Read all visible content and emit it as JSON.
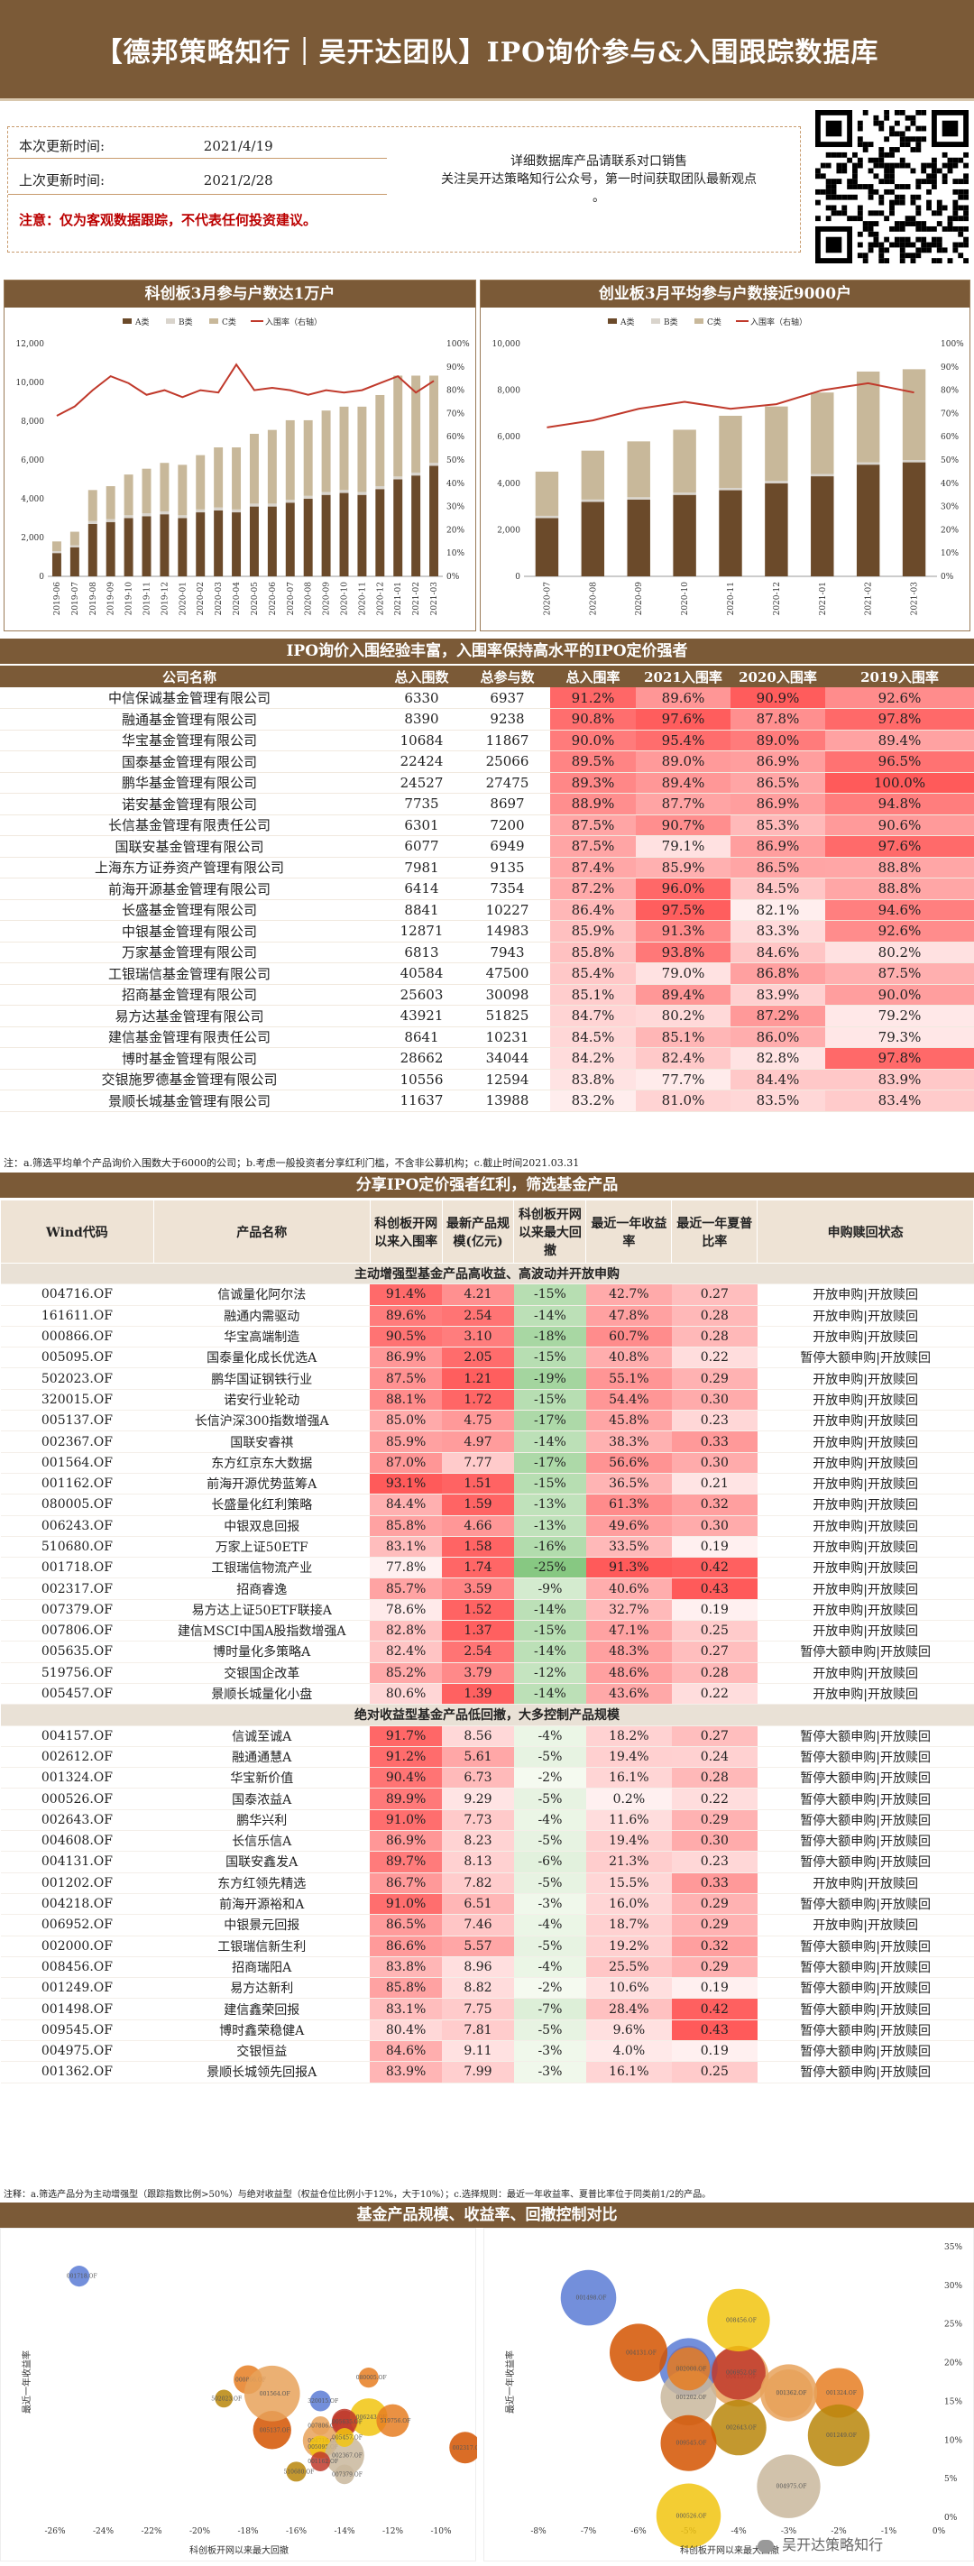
{
  "header": {
    "title": "【德邦策略知行｜吴开达团队】IPO询价参与&入围跟踪数据库"
  },
  "info": {
    "this_update_label": "本次更新时间:",
    "this_update": "2021/4/19",
    "last_update_label": "上次更新时间:",
    "last_update": "2021/2/28",
    "note": "注意：仅为客观数据跟踪，不代表任何投资建议。",
    "contact": "详细数据库产品请联系对口销售",
    "follow": "关注吴开达策略知行公众号，第一时间获取团队最新观点",
    "follow_tail": "。"
  },
  "chart1": {
    "title": "科创板3月参与户数达1万户",
    "legend": [
      "A类",
      "B类",
      "C类",
      "入围率（右轴）"
    ]
  },
  "chart2": {
    "title": "创业板3月平均参与户数接近9000户",
    "legend": [
      "A类",
      "B类",
      "C类",
      "入围率（右轴）"
    ]
  },
  "chart_data": [
    {
      "type": "bar",
      "stacked": true,
      "categories": [
        "2019-06",
        "2019-07",
        "2019-08",
        "2019-09",
        "2019-10",
        "2019-11",
        "2019-12",
        "2020-01",
        "2020-02",
        "2020-03",
        "2020-04",
        "2020-05",
        "2020-06",
        "2020-07",
        "2020-08",
        "2020-09",
        "2020-10",
        "2020-11",
        "2020-12",
        "2021-01",
        "2021-02",
        "2021-03"
      ],
      "series": [
        {
          "name": "A类",
          "values": [
            1200,
            1500,
            2700,
            2800,
            3000,
            3100,
            3200,
            3000,
            3300,
            3400,
            3300,
            3600,
            3600,
            3800,
            4000,
            4200,
            4300,
            4200,
            4500,
            5000,
            5200,
            5700
          ]
        },
        {
          "name": "B类",
          "values": [
            100,
            100,
            150,
            150,
            150,
            150,
            150,
            150,
            150,
            150,
            150,
            150,
            150,
            150,
            150,
            150,
            150,
            150,
            150,
            150,
            150,
            150
          ]
        },
        {
          "name": "C类",
          "values": [
            500,
            700,
            1600,
            1700,
            2100,
            2300,
            2500,
            2600,
            2800,
            3100,
            3200,
            3600,
            3800,
            4100,
            3900,
            4200,
            4300,
            4400,
            4700,
            5200,
            5000,
            4500
          ]
        }
      ],
      "line": {
        "name": "入围率（右轴）",
        "values": [
          69,
          73,
          80,
          86,
          83,
          78,
          80,
          77,
          80,
          79,
          91,
          80,
          81,
          80,
          78,
          80,
          79,
          80,
          83,
          86,
          79,
          84
        ]
      },
      "ylim": [
        0,
        12000
      ],
      "y2lim": [
        0,
        100
      ]
    },
    {
      "type": "bar",
      "stacked": true,
      "categories": [
        "2020-07",
        "2020-08",
        "2020-09",
        "2020-10",
        "2020-11",
        "2020-12",
        "2021-01",
        "2021-02",
        "2021-03"
      ],
      "series": [
        {
          "name": "A类",
          "values": [
            2500,
            3200,
            3300,
            3500,
            3700,
            4000,
            4300,
            4800,
            4900
          ]
        },
        {
          "name": "B类",
          "values": [
            100,
            100,
            100,
            100,
            100,
            100,
            100,
            100,
            100
          ]
        },
        {
          "name": "C类",
          "values": [
            1900,
            2100,
            2400,
            2700,
            3100,
            3200,
            3500,
            3900,
            3900
          ]
        }
      ],
      "line": {
        "name": "入围率（右轴）",
        "values": [
          64,
          67,
          72,
          75,
          72,
          74,
          80,
          83,
          79
        ]
      },
      "ylim": [
        0,
        10000
      ],
      "y2lim": [
        0,
        100
      ]
    }
  ],
  "table1": {
    "banner": "IPO询价入围经验丰富，入围率保持高水平的IPO定价强者",
    "headers": [
      "公司名称",
      "总入围数",
      "总参与数",
      "总入围率",
      "2021入围率",
      "2020入围率",
      "2019入围率"
    ],
    "rows": [
      [
        "中信保诚基金管理有限公司",
        "6330",
        "6937",
        "91.2%",
        "89.6%",
        "90.9%",
        "92.6%"
      ],
      [
        "融通基金管理有限公司",
        "8390",
        "9238",
        "90.8%",
        "97.6%",
        "87.8%",
        "97.8%"
      ],
      [
        "华宝基金管理有限公司",
        "10684",
        "11867",
        "90.0%",
        "95.4%",
        "89.0%",
        "89.4%"
      ],
      [
        "国泰基金管理有限公司",
        "22424",
        "25066",
        "89.5%",
        "89.0%",
        "86.9%",
        "96.5%"
      ],
      [
        "鹏华基金管理有限公司",
        "24527",
        "27475",
        "89.3%",
        "89.4%",
        "86.5%",
        "100.0%"
      ],
      [
        "诺安基金管理有限公司",
        "7735",
        "8697",
        "88.9%",
        "87.7%",
        "86.9%",
        "94.8%"
      ],
      [
        "长信基金管理有限责任公司",
        "6301",
        "7200",
        "87.5%",
        "90.7%",
        "85.3%",
        "90.6%"
      ],
      [
        "国联安基金管理有限公司",
        "6077",
        "6949",
        "87.5%",
        "79.1%",
        "86.9%",
        "97.6%"
      ],
      [
        "上海东方证券资产管理有限公司",
        "7981",
        "9135",
        "87.4%",
        "85.9%",
        "86.5%",
        "88.8%"
      ],
      [
        "前海开源基金管理有限公司",
        "6414",
        "7354",
        "87.2%",
        "96.0%",
        "84.5%",
        "88.8%"
      ],
      [
        "长盛基金管理有限公司",
        "8841",
        "10227",
        "86.4%",
        "97.5%",
        "82.1%",
        "94.6%"
      ],
      [
        "中银基金管理有限公司",
        "12871",
        "14983",
        "85.9%",
        "91.3%",
        "83.3%",
        "92.6%"
      ],
      [
        "万家基金管理有限公司",
        "6813",
        "7943",
        "85.8%",
        "93.8%",
        "84.6%",
        "80.2%"
      ],
      [
        "工银瑞信基金管理有限公司",
        "40584",
        "47500",
        "85.4%",
        "79.0%",
        "86.8%",
        "87.5%"
      ],
      [
        "招商基金管理有限公司",
        "25603",
        "30098",
        "85.1%",
        "89.4%",
        "83.9%",
        "90.0%"
      ],
      [
        "易方达基金管理有限公司",
        "43921",
        "51825",
        "84.7%",
        "80.2%",
        "87.2%",
        "79.2%"
      ],
      [
        "建信基金管理有限责任公司",
        "8641",
        "10231",
        "84.5%",
        "85.1%",
        "86.0%",
        "79.3%"
      ],
      [
        "博时基金管理有限公司",
        "28662",
        "34044",
        "84.2%",
        "82.4%",
        "82.8%",
        "97.8%"
      ],
      [
        "交银施罗德基金管理有限公司",
        "10556",
        "12594",
        "83.8%",
        "77.7%",
        "84.4%",
        "83.9%"
      ],
      [
        "景顺长城基金管理有限公司",
        "11637",
        "13988",
        "83.2%",
        "81.0%",
        "83.5%",
        "83.4%"
      ]
    ],
    "note": "注：a.筛选平均单个产品询价入围数大于6000的公司；b.考虑一般投资者分享红利门槛，不含非公募机构；c.截止时间2021.03.31"
  },
  "table2": {
    "banner": "分享IPO定价强者红利，筛选基金产品",
    "headers": [
      "Wind代码",
      "产品名称",
      "科创板开网以来入围率",
      "最新产品规模(亿元)",
      "科创板开网以来最大回撤",
      "最近一年收益率",
      "最近一年夏普比率",
      "申购赎回状态"
    ],
    "group1": "主动增强型基金产品高收益、高波动并开放申购",
    "group2": "绝对收益型基金产品低回撤，大多控制产品规模",
    "rows1": [
      [
        "004716.OF",
        "信诚量化阿尔法",
        "91.4%",
        "4.21",
        "-15%",
        "42.7%",
        "0.27",
        "开放申购|开放赎回"
      ],
      [
        "161611.OF",
        "融通内需驱动",
        "89.6%",
        "2.54",
        "-14%",
        "47.8%",
        "0.28",
        "开放申购|开放赎回"
      ],
      [
        "000866.OF",
        "华宝高端制造",
        "90.5%",
        "3.10",
        "-18%",
        "60.7%",
        "0.28",
        "开放申购|开放赎回"
      ],
      [
        "005095.OF",
        "国泰量化成长优选A",
        "86.9%",
        "2.05",
        "-15%",
        "40.8%",
        "0.22",
        "暂停大额申购|开放赎回"
      ],
      [
        "502023.OF",
        "鹏华国证钢铁行业",
        "87.5%",
        "1.21",
        "-19%",
        "55.1%",
        "0.29",
        "开放申购|开放赎回"
      ],
      [
        "320015.OF",
        "诺安行业轮动",
        "88.1%",
        "1.72",
        "-15%",
        "54.4%",
        "0.30",
        "开放申购|开放赎回"
      ],
      [
        "005137.OF",
        "长信沪深300指数增强A",
        "85.0%",
        "4.75",
        "-17%",
        "45.8%",
        "0.23",
        "开放申购|开放赎回"
      ],
      [
        "002367.OF",
        "国联安睿祺",
        "85.9%",
        "4.97",
        "-14%",
        "38.3%",
        "0.33",
        "开放申购|开放赎回"
      ],
      [
        "001564.OF",
        "东方红京东大数据",
        "87.0%",
        "7.77",
        "-17%",
        "56.6%",
        "0.30",
        "开放申购|开放赎回"
      ],
      [
        "001162.OF",
        "前海开源优势蓝筹A",
        "93.1%",
        "1.51",
        "-15%",
        "36.5%",
        "0.21",
        "开放申购|开放赎回"
      ],
      [
        "080005.OF",
        "长盛量化红利策略",
        "84.4%",
        "1.59",
        "-13%",
        "61.3%",
        "0.32",
        "开放申购|开放赎回"
      ],
      [
        "006243.OF",
        "中银双息回报",
        "85.8%",
        "4.66",
        "-13%",
        "49.6%",
        "0.30",
        "开放申购|开放赎回"
      ],
      [
        "510680.OF",
        "万家上证50ETF",
        "83.1%",
        "1.58",
        "-16%",
        "33.5%",
        "0.19",
        "开放申购|开放赎回"
      ],
      [
        "001718.OF",
        "工银瑞信物流产业",
        "77.8%",
        "1.74",
        "-25%",
        "91.3%",
        "0.42",
        "开放申购|开放赎回"
      ],
      [
        "002317.OF",
        "招商睿逸",
        "85.7%",
        "3.59",
        "-9%",
        "40.6%",
        "0.43",
        "开放申购|开放赎回"
      ],
      [
        "007379.OF",
        "易方达上证50ETF联接A",
        "78.6%",
        "1.52",
        "-14%",
        "32.7%",
        "0.19",
        "开放申购|开放赎回"
      ],
      [
        "007806.OF",
        "建信MSCI中国A股指数增强A",
        "82.8%",
        "1.37",
        "-15%",
        "47.1%",
        "0.25",
        "开放申购|开放赎回"
      ],
      [
        "005635.OF",
        "博时量化多策略A",
        "82.4%",
        "2.54",
        "-14%",
        "48.3%",
        "0.27",
        "暂停大额申购|开放赎回"
      ],
      [
        "519756.OF",
        "交银国企改革",
        "85.2%",
        "3.79",
        "-12%",
        "48.6%",
        "0.28",
        "开放申购|开放赎回"
      ],
      [
        "005457.OF",
        "景顺长城量化小盘",
        "80.6%",
        "1.39",
        "-14%",
        "43.6%",
        "0.22",
        "开放申购|开放赎回"
      ]
    ],
    "rows2": [
      [
        "004157.OF",
        "信诚至诚A",
        "91.7%",
        "8.56",
        "-4%",
        "18.2%",
        "0.27",
        "暂停大额申购|开放赎回"
      ],
      [
        "002612.OF",
        "融通通慧A",
        "91.2%",
        "5.61",
        "-5%",
        "19.4%",
        "0.24",
        "暂停大额申购|开放赎回"
      ],
      [
        "001324.OF",
        "华宝新价值",
        "90.4%",
        "6.73",
        "-2%",
        "16.1%",
        "0.28",
        "暂停大额申购|开放赎回"
      ],
      [
        "000526.OF",
        "国泰浓益A",
        "89.9%",
        "9.29",
        "-5%",
        "0.2%",
        "0.22",
        "暂停大额申购|开放赎回"
      ],
      [
        "002643.OF",
        "鹏华兴利",
        "91.0%",
        "7.73",
        "-4%",
        "11.6%",
        "0.29",
        "暂停大额申购|开放赎回"
      ],
      [
        "004608.OF",
        "长信乐信A",
        "86.9%",
        "8.23",
        "-5%",
        "19.4%",
        "0.30",
        "暂停大额申购|开放赎回"
      ],
      [
        "004131.OF",
        "国联安鑫发A",
        "89.7%",
        "8.13",
        "-6%",
        "21.3%",
        "0.23",
        "暂停大额申购|开放赎回"
      ],
      [
        "001202.OF",
        "东方红领先精选",
        "86.7%",
        "7.82",
        "-5%",
        "15.5%",
        "0.33",
        "开放申购|开放赎回"
      ],
      [
        "004218.OF",
        "前海开源裕和A",
        "91.0%",
        "6.51",
        "-3%",
        "16.0%",
        "0.29",
        "暂停大额申购|开放赎回"
      ],
      [
        "006952.OF",
        "中银景元回报",
        "86.5%",
        "7.46",
        "-4%",
        "18.7%",
        "0.29",
        "开放申购|开放赎回"
      ],
      [
        "002000.OF",
        "工银瑞信新生利",
        "86.6%",
        "5.57",
        "-5%",
        "19.2%",
        "0.32",
        "暂停大额申购|开放赎回"
      ],
      [
        "008456.OF",
        "招商瑞阳A",
        "83.8%",
        "8.96",
        "-4%",
        "25.5%",
        "0.29",
        "暂停大额申购|开放赎回"
      ],
      [
        "001249.OF",
        "易方达新利",
        "85.8%",
        "8.82",
        "-2%",
        "10.6%",
        "0.19",
        "暂停大额申购|开放赎回"
      ],
      [
        "001498.OF",
        "建信鑫荣回报",
        "83.1%",
        "7.75",
        "-7%",
        "28.4%",
        "0.42",
        "暂停大额申购|开放赎回"
      ],
      [
        "009545.OF",
        "博时鑫荣稳健A",
        "80.4%",
        "7.81",
        "-5%",
        "9.6%",
        "0.43",
        "暂停大额申购|开放赎回"
      ],
      [
        "004975.OF",
        "交银恒益",
        "84.6%",
        "9.11",
        "-3%",
        "4.0%",
        "0.19",
        "暂停大额申购|开放赎回"
      ],
      [
        "001362.OF",
        "景顺长城领先回报A",
        "83.9%",
        "7.99",
        "-3%",
        "16.1%",
        "0.25",
        "暂停大额申购|开放赎回"
      ]
    ],
    "note": "注释：a.筛选产品分为主动增强型（跟踪指数比例>50%）与绝对收益型（权益仓位比例小于12%，大于10%）；c.选择规则：最近一年收益率、夏普比率位于同类前1/2的产品。"
  },
  "scatter": {
    "banner": "基金产品规模、收益率、回撤控制对比",
    "left_ylabel": "最近一年收益率",
    "left_xlabel": "科创板开网以来最大回撤",
    "right_ylabel": "最近一年收益率",
    "right_xlabel": "科创板开网以来最大回撤",
    "left_xticks": [
      "-26%",
      "-24%",
      "-22%",
      "-20%",
      "-18%",
      "-16%",
      "-14%",
      "-12%",
      "-10%"
    ],
    "right_xticks": [
      "-8%",
      "-7%",
      "-6%",
      "-5%",
      "-4%",
      "-3%",
      "-2%",
      "-1%",
      "0%"
    ],
    "right_yticks": [
      "0%",
      "5%",
      "10%",
      "15%",
      "20%",
      "25%",
      "30%",
      "35%"
    ],
    "watermark": "吴开达策略知行"
  }
}
